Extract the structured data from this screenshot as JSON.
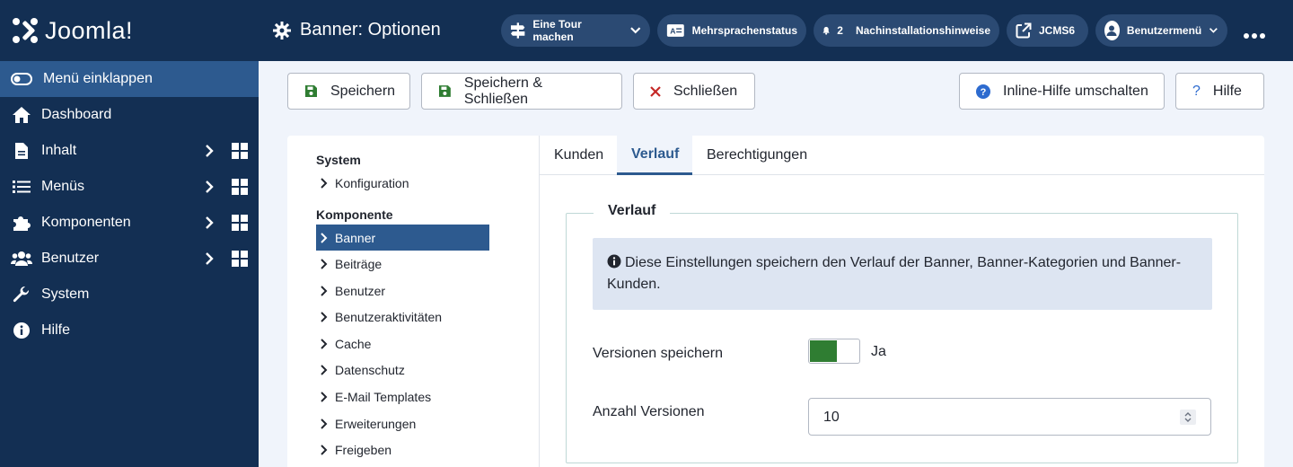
{
  "brand": {
    "logo_text": "Joomla!",
    "colors": {
      "sidebar": "#132f53",
      "accent": "#2d5a8f",
      "toggle_on": "#2f7d32"
    }
  },
  "sidebar": {
    "collapse_label": "Menü einklappen",
    "items": [
      {
        "label": "Dashboard",
        "icon": "home-icon"
      },
      {
        "label": "Inhalt",
        "icon": "file-icon"
      },
      {
        "label": "Menüs",
        "icon": "list-icon"
      },
      {
        "label": "Komponenten",
        "icon": "puzzle-icon"
      },
      {
        "label": "Benutzer",
        "icon": "users-icon"
      },
      {
        "label": "System",
        "icon": "wrench-icon"
      },
      {
        "label": "Hilfe",
        "icon": "info-icon"
      }
    ]
  },
  "header": {
    "title": "Banner: Optionen",
    "tour": "Eine Tour machen",
    "multilang": "Mehrsprachenstatus",
    "notif_count": "2",
    "postinstall": "Nachinstallationshinweise",
    "site": "JCMS6",
    "user_menu": "Benutzermenü"
  },
  "toolbar": {
    "save": "Speichern",
    "save_close": "Speichern & Schließen",
    "close": "Schließen",
    "inline_help": "Inline-Hilfe umschalten",
    "help": "Hilfe"
  },
  "config_nav": {
    "system_heading": "System",
    "system_items": [
      "Konfiguration"
    ],
    "component_heading": "Komponente",
    "component_items": [
      "Banner",
      "Beiträge",
      "Benutzer",
      "Benutzeraktivitäten",
      "Cache",
      "Datenschutz",
      "E-Mail Templates",
      "Erweiterungen",
      "Freigeben"
    ],
    "active": "Banner"
  },
  "tabs": [
    "Kunden",
    "Verlauf",
    "Berechtigungen"
  ],
  "active_tab": "Verlauf",
  "history": {
    "legend": "Verlauf",
    "info_line1": "Diese Einstellungen speichern den Verlauf der Banner, Banner-Kategorien und Banner-",
    "info_line2": "Kunden.",
    "save_versions_label": "Versionen speichern",
    "save_versions_value": "Ja",
    "max_versions_label": "Anzahl Versionen",
    "max_versions_value": "10"
  }
}
